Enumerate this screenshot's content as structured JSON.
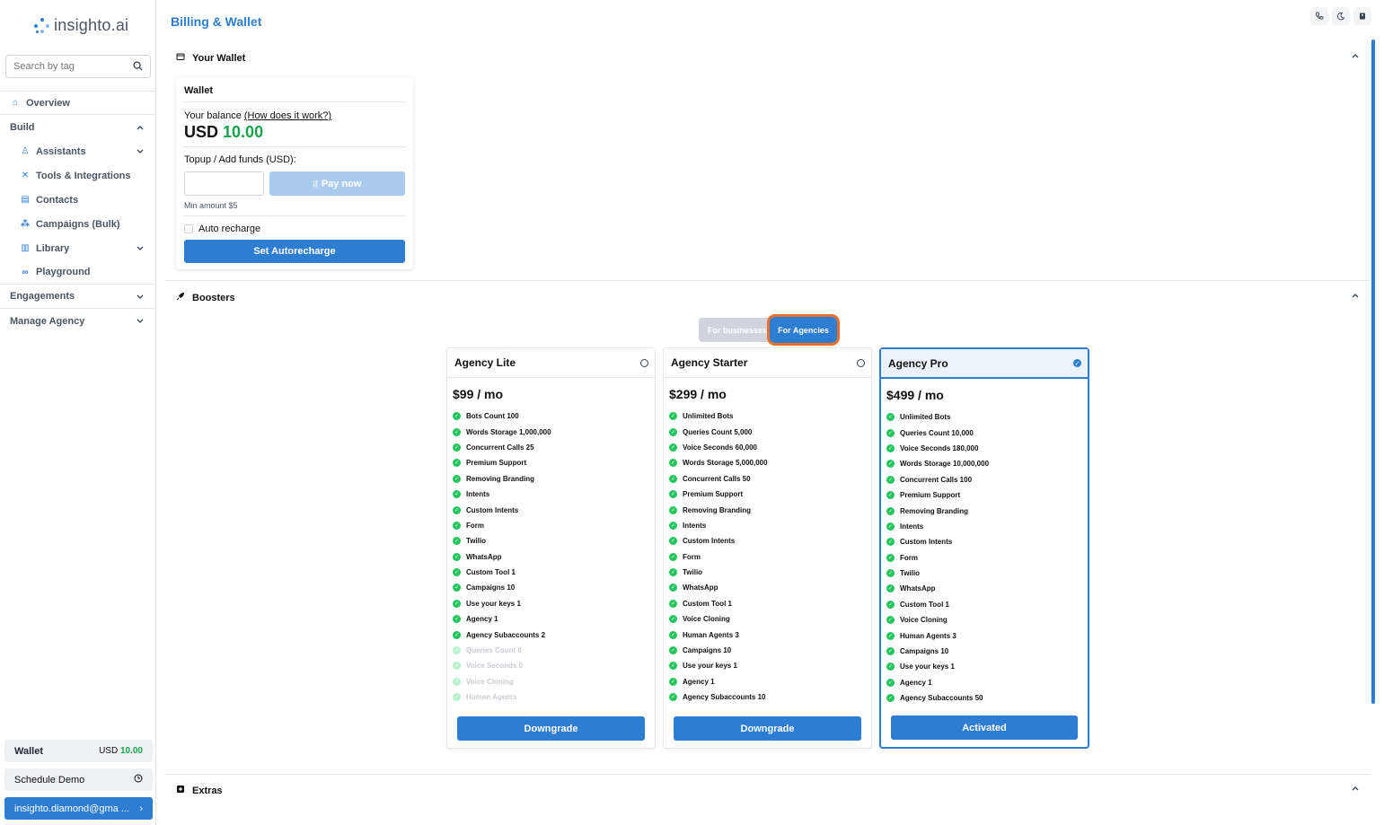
{
  "app": {
    "logo_text": "insighto.ai",
    "page_title": "Billing & Wallet"
  },
  "sidebar": {
    "search_placeholder": "Search by tag",
    "overview": "Overview",
    "build": "Build",
    "items": [
      {
        "label": "Assistants",
        "icon": "user-icon"
      },
      {
        "label": "Tools & Integrations",
        "icon": "tools-icon"
      },
      {
        "label": "Contacts",
        "icon": "contacts-icon"
      },
      {
        "label": "Campaigns (Bulk)",
        "icon": "campaign-icon"
      },
      {
        "label": "Library",
        "icon": "library-icon"
      },
      {
        "label": "Playground",
        "icon": "gamepad-icon"
      }
    ],
    "engagements": "Engagements",
    "manage_agency": "Manage Agency",
    "wallet_label": "Wallet",
    "wallet_currency": "USD",
    "wallet_amount": "10.00",
    "schedule_demo": "Schedule Demo",
    "user_email": "insighto.diamond@gma ..."
  },
  "wallet_section": {
    "title": "Your Wallet",
    "card_title": "Wallet",
    "balance_label": "Your balance",
    "how_link": "(How does it work?)",
    "currency": "USD",
    "amount": "10.00",
    "topup_label": "Topup / Add funds (USD):",
    "pay_button": "Pay now",
    "min_amount": "Min amount $5",
    "auto_recharge": "Auto recharge",
    "set_button": "Set Autorecharge"
  },
  "boosters": {
    "title": "Boosters",
    "toggle_business": "For businesses",
    "toggle_agencies": "For Agencies",
    "plans": [
      {
        "name": "Agency Lite",
        "price": "$99 / mo",
        "button": "Downgrade",
        "selected": false,
        "features": [
          "Bots Count 100",
          "Words Storage 1,000,000",
          "Concurrent Calls 25",
          "Premium Support",
          "Removing Branding",
          "Intents",
          "Custom Intents",
          "Form",
          "Twilio",
          "WhatsApp",
          "Custom Tool 1",
          "Campaigns 10",
          "Use your keys 1",
          "Agency 1",
          "Agency Subaccounts 2"
        ],
        "disabled": [
          "Queries Count 0",
          "Voice Seconds 0",
          "Voice Cloning",
          "Human Agents"
        ]
      },
      {
        "name": "Agency Starter",
        "price": "$299 / mo",
        "button": "Downgrade",
        "selected": false,
        "features": [
          "Unlimited Bots",
          "Queries Count 5,000",
          "Voice Seconds 60,000",
          "Words Storage 5,000,000",
          "Concurrent Calls 50",
          "Premium Support",
          "Removing Branding",
          "Intents",
          "Custom Intents",
          "Form",
          "Twilio",
          "WhatsApp",
          "Custom Tool 1",
          "Voice Cloning",
          "Human Agents 3",
          "Campaigns 10",
          "Use your keys 1",
          "Agency 1",
          "Agency Subaccounts 10"
        ],
        "disabled": []
      },
      {
        "name": "Agency Pro",
        "price": "$499 / mo",
        "button": "Activated",
        "selected": true,
        "features": [
          "Unlimited Bots",
          "Queries Count 10,000",
          "Voice Seconds 180,000",
          "Words Storage 10,000,000",
          "Concurrent Calls 100",
          "Premium Support",
          "Removing Branding",
          "Intents",
          "Custom Intents",
          "Form",
          "Twilio",
          "WhatsApp",
          "Custom Tool 1",
          "Voice Cloning",
          "Human Agents 3",
          "Campaigns 10",
          "Use your keys 1",
          "Agency 1",
          "Agency Subaccounts 50"
        ],
        "disabled": []
      }
    ]
  },
  "extras": {
    "title": "Extras"
  },
  "colors": {
    "accent": "#2d7dd2",
    "success": "#16a34a",
    "highlight": "#e8702a"
  }
}
